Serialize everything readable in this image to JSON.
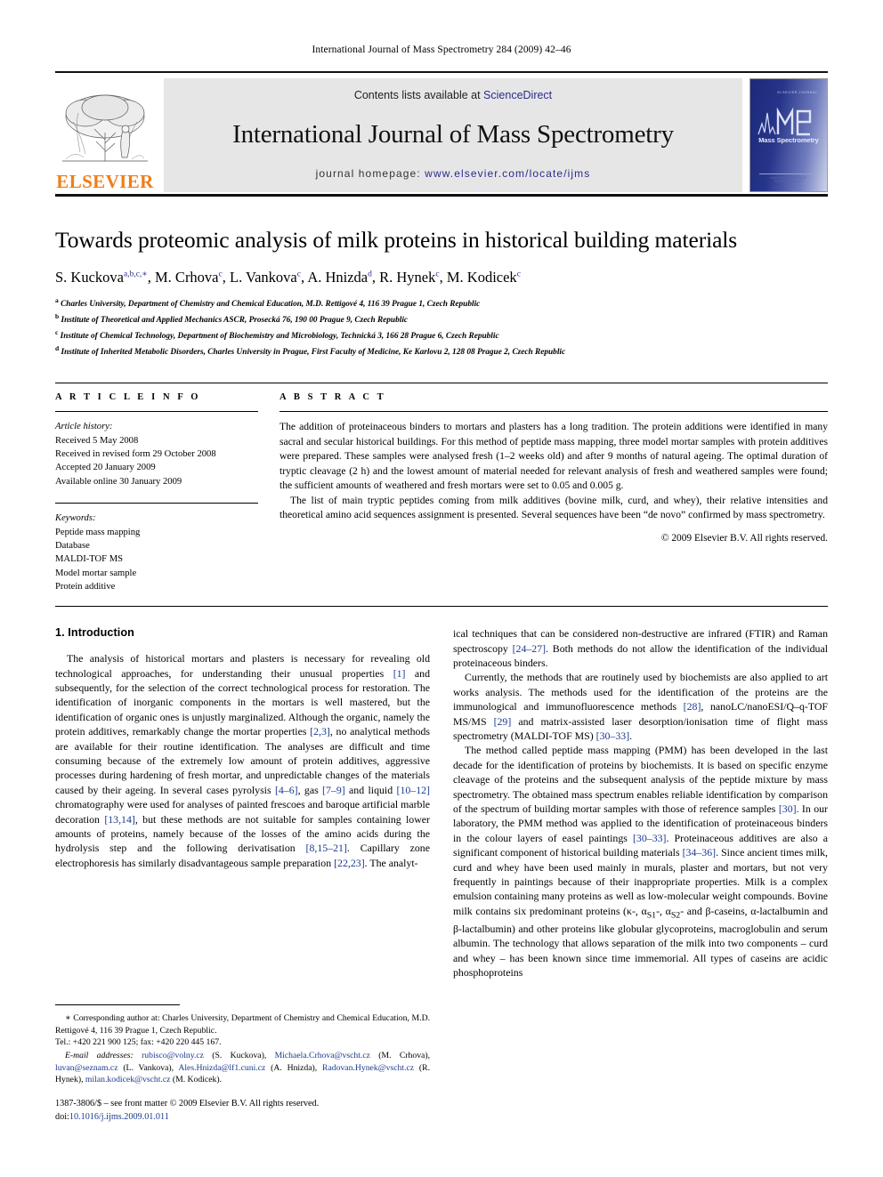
{
  "running_head": "International Journal of Mass Spectrometry 284 (2009) 42–46",
  "masthead": {
    "publisher_name": "ELSEVIER",
    "contents_prefix": "Contents lists available at ",
    "contents_link": "ScienceDirect",
    "journal_title": "International Journal of Mass Spectrometry",
    "homepage_prefix": "journal homepage: ",
    "homepage_url": "www.elsevier.com/locate/ijms",
    "cover_kicker": "ELSEVIER  JOURNAL",
    "cover_caption": "Mass Spectrometry",
    "cover_footer": "AVAILABLE ONLINE AT SCIENCEDIRECT"
  },
  "article": {
    "title": "Towards proteomic analysis of milk proteins in historical building materials",
    "authors": [
      {
        "name": "S. Kuckova",
        "marks": "a,b,c,∗"
      },
      {
        "name": "M. Crhova",
        "marks": "c"
      },
      {
        "name": "L. Vankova",
        "marks": "c"
      },
      {
        "name": "A. Hnizda",
        "marks": "d"
      },
      {
        "name": "R. Hynek",
        "marks": "c"
      },
      {
        "name": "M. Kodicek",
        "marks": "c"
      }
    ],
    "affiliations": [
      {
        "mark": "a",
        "text": "Charles University, Department of Chemistry and Chemical Education, M.D. Rettigové 4, 116 39 Prague 1, Czech Republic"
      },
      {
        "mark": "b",
        "text": "Institute of Theoretical and Applied Mechanics ASCR, Prosecká 76, 190 00 Prague 9, Czech Republic"
      },
      {
        "mark": "c",
        "text": "Institute of Chemical Technology, Department of Biochemistry and Microbiology, Technická 3, 166 28 Prague 6, Czech Republic"
      },
      {
        "mark": "d",
        "text": "Institute of Inherited Metabolic Disorders, Charles University in Prague, First Faculty of Medicine, Ke Karlovu 2, 128 08 Prague 2, Czech Republic"
      }
    ]
  },
  "article_info": {
    "heading": "A R T I C L E   I N F O",
    "history_label": "Article history:",
    "history": [
      "Received 5 May 2008",
      "Received in revised form 29 October 2008",
      "Accepted 20 January 2009",
      "Available online 30 January 2009"
    ],
    "keywords_label": "Keywords:",
    "keywords": [
      "Peptide mass mapping",
      "Database",
      "MALDI-TOF MS",
      "Model mortar sample",
      "Protein additive"
    ]
  },
  "abstract": {
    "heading": "A B S T R A C T",
    "paragraphs": [
      "The addition of proteinaceous binders to mortars and plasters has a long tradition. The protein additions were identified in many sacral and secular historical buildings. For this method of peptide mass mapping, three model mortar samples with protein additives were prepared. These samples were analysed fresh (1–2 weeks old) and after 9 months of natural ageing. The optimal duration of tryptic cleavage (2 h) and the lowest amount of material needed for relevant analysis of fresh and weathered samples were found; the sufficient amounts of weathered and fresh mortars were set to 0.05 and 0.005 g.",
      "The list of main tryptic peptides coming from milk additives (bovine milk, curd, and whey), their relative intensities and theoretical amino acid sequences assignment is presented. Several sequences have been “de novo” confirmed by mass spectrometry."
    ],
    "copyright": "© 2009 Elsevier B.V. All rights reserved."
  },
  "body": {
    "section_number_title": "1.  Introduction",
    "left_paragraph_1_a": "The analysis of historical mortars and plasters is necessary for revealing old technological approaches, for understanding their unusual properties ",
    "left_cite_1": "[1]",
    "left_paragraph_1_b": " and subsequently, for the selection of the correct technological process for restoration. The identification of inorganic components in the mortars is well mastered, but the identification of organic ones is unjustly marginalized. Although the organic, namely the protein additives, remarkably change the mortar properties ",
    "left_cite_2": "[2,3]",
    "left_paragraph_1_c": ", no analytical methods are available for their routine identification. The analyses are difficult and time consuming because of the extremely low amount of protein additives, aggressive processes during hardening of fresh mortar, and unpredictable changes of the materials caused by their ageing. In several cases pyrolysis ",
    "left_cite_3": "[4–6]",
    "left_paragraph_1_d": ", gas ",
    "left_cite_4": "[7–9]",
    "left_paragraph_1_e": " and liquid ",
    "left_cite_5": "[10–12]",
    "left_paragraph_1_f": " chromatography were used for analyses of painted frescoes and baroque artificial marble decoration ",
    "left_cite_6": "[13,14]",
    "left_paragraph_1_g": ", but these methods are not suitable for samples containing lower amounts of proteins, namely because of the losses of the amino acids during the hydrolysis step and the following derivatisation ",
    "left_cite_7": "[8,15–21]",
    "left_paragraph_1_h": ". Capillary zone electrophoresis has similarly disadvantageous sample preparation ",
    "left_cite_8": "[22,23]",
    "left_paragraph_1_i": ". The analyt-",
    "right_paragraph_1_a": "ical techniques that can be considered non-destructive are infrared (FTIR) and Raman spectroscopy ",
    "right_cite_1": "[24–27]",
    "right_paragraph_1_b": ". Both methods do not allow the identification of the individual proteinaceous binders.",
    "right_paragraph_2_a": "Currently, the methods that are routinely used by biochemists are also applied to art works analysis. The methods used for the identification of the proteins are the immunological and immunofluorescence methods ",
    "right_cite_2": "[28]",
    "right_paragraph_2_b": ", nanoLC/nanoESI/Q–q-TOF MS/MS ",
    "right_cite_3": "[29]",
    "right_paragraph_2_c": " and matrix-assisted laser desorption/ionisation time of flight mass spectrometry (MALDI-TOF MS) ",
    "right_cite_4": "[30–33]",
    "right_paragraph_2_d": ".",
    "right_paragraph_3_a": "The method called peptide mass mapping (PMM) has been developed in the last decade for the identification of proteins by biochemists. It is based on specific enzyme cleavage of the proteins and the subsequent analysis of the peptide mixture by mass spectrometry. The obtained mass spectrum enables reliable identification by comparison of the spectrum of building mortar samples with those of reference samples ",
    "right_cite_5": "[30]",
    "right_paragraph_3_b": ". In our laboratory, the PMM method was applied to the identification of proteinaceous binders in the colour layers of easel paintings ",
    "right_cite_6": "[30–33]",
    "right_paragraph_3_c": ". Proteinaceous additives are also a significant component of historical building materials ",
    "right_cite_7": "[34–36]",
    "right_paragraph_3_d": ". Since ancient times milk, curd and whey have been used mainly in murals, plaster and mortars, but not very frequently in paintings because of their inappropriate properties. Milk is a complex emulsion containing many proteins as well as low-molecular weight compounds. Bovine milk contains six predominant proteins (κ-, α",
    "right_sub_1": "S1",
    "right_paragraph_3_e": "-, α",
    "right_sub_2": "S2",
    "right_paragraph_3_f": "- and β-caseins, α-lactalbumin and β-lactalbumin) and other proteins like globular glycoproteins, macroglobulin and serum albumin. The technology that allows separation of the milk into two components – curd and whey – has been known since time immemorial. All types of caseins are acidic phosphoproteins"
  },
  "footnote": {
    "corresponding_mark": "∗",
    "corresponding_text": "Corresponding author at: Charles University, Department of Chemistry and Chemical Education, M.D. Rettigové 4, 116 39 Prague 1, Czech Republic.",
    "tel_fax": "Tel.: +420 221 900 125; fax: +420 220 445 167.",
    "email_label": "E-mail addresses:",
    "emails": [
      {
        "address": "rubisco@volny.cz",
        "person": "(S. Kuckova)"
      },
      {
        "address": "Michaela.Crhova@vscht.cz",
        "person": "(M. Crhova)"
      },
      {
        "address": "luvan@seznam.cz",
        "person": "(L. Vankova)"
      },
      {
        "address": "Ales.Hnizda@lf1.cuni.cz",
        "person": "(A. Hnizda)"
      },
      {
        "address": "Radovan.Hynek@vscht.cz",
        "person": "(R. Hynek)"
      },
      {
        "address": "milan.kodicek@vscht.cz",
        "person": "(M. Kodicek)"
      }
    ],
    "issn_line": "1387-3806/$ – see front matter © 2009 Elsevier B.V. All rights reserved.",
    "doi_label": "doi:",
    "doi_value": "10.1016/j.ijms.2009.01.011"
  }
}
